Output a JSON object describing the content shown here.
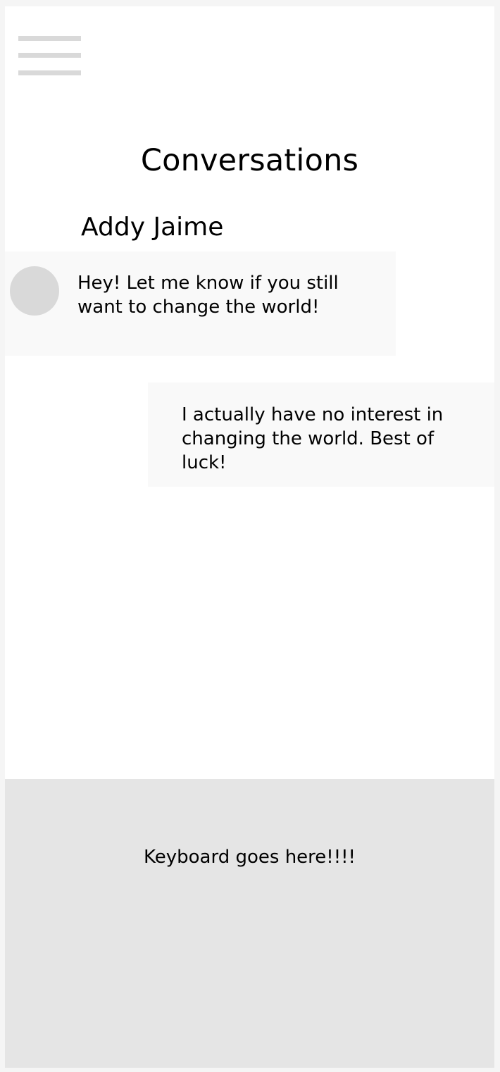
{
  "header": {
    "menu_icon": "hamburger-menu-icon",
    "title": "Conversations"
  },
  "conversation": {
    "contact_name": "Addy Jaime",
    "messages": [
      {
        "direction": "incoming",
        "avatar": true,
        "text": "Hey! Let me know if you still want to change the world!"
      },
      {
        "direction": "outgoing",
        "avatar": false,
        "text": "I actually have no interest in changing the world. Best of luck!"
      }
    ]
  },
  "keyboard": {
    "placeholder_text": "Keyboard goes here!!!!"
  },
  "colors": {
    "background": "#ffffff",
    "outer_frame": "#f5f5f5",
    "message_bubble": "#f9f9f9",
    "avatar": "#d9d9d9",
    "menu_bars": "#d9d9d9",
    "keyboard_area": "#e5e5e5",
    "text": "#000000"
  }
}
